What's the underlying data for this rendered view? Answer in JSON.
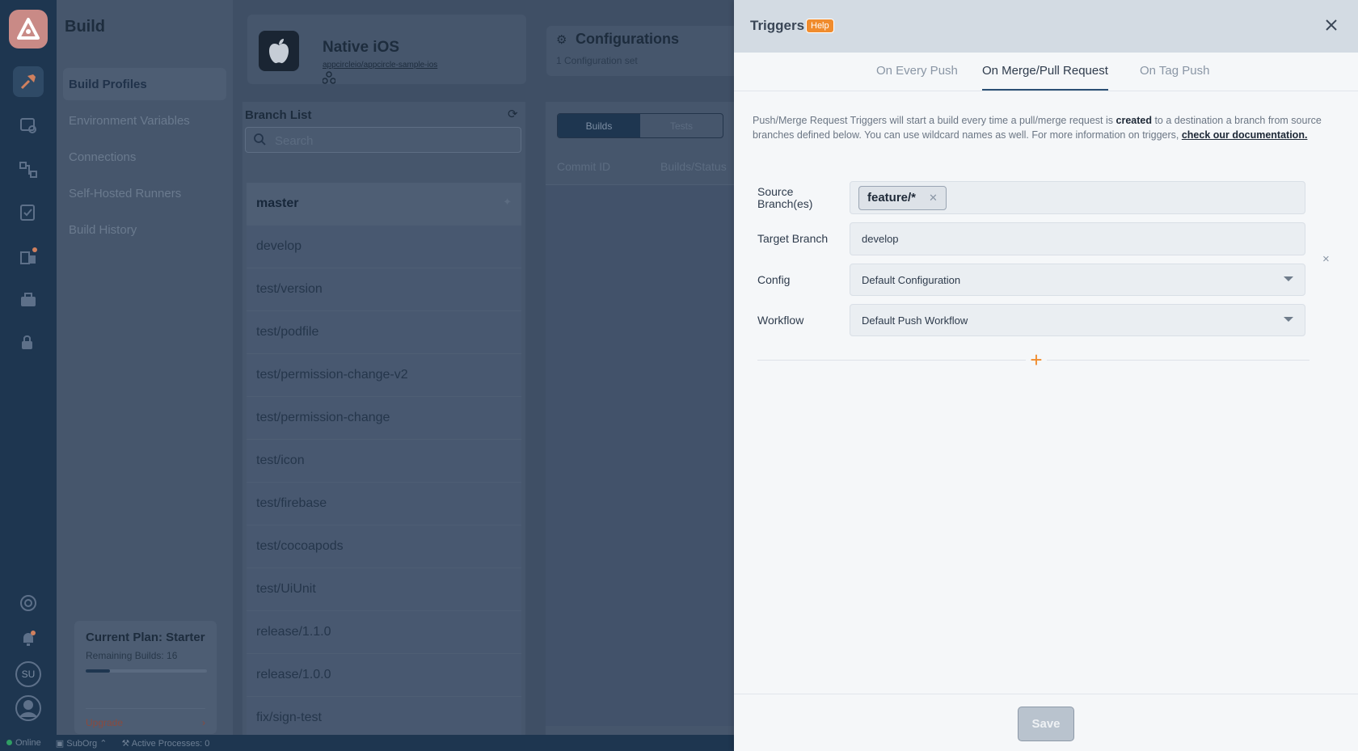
{
  "rail": {
    "icons": [
      "logo-icon",
      "build-hammer-icon",
      "distribution-icon",
      "flow-icon",
      "testing-icon",
      "store-icon",
      "briefcase-icon",
      "lock-icon",
      "support-icon",
      "bell-icon",
      "user-icon"
    ],
    "avatar_initials": "SU"
  },
  "subnav": {
    "title": "Build",
    "items": [
      {
        "label": "Build Profiles",
        "active": true
      },
      {
        "label": "Environment Variables"
      },
      {
        "label": "Connections"
      },
      {
        "label": "Self-Hosted Runners"
      },
      {
        "label": "Build History"
      }
    ],
    "plan": {
      "title": "Current Plan: Starter",
      "remaining": "Remaining Builds: 16",
      "remaining_fraction": 0.2,
      "upgrade": "Upgrade"
    }
  },
  "profile": {
    "name": "Native iOS",
    "repo": "appcircleio/appcircle-sample-ios"
  },
  "configurations": {
    "title": "Configurations",
    "subtitle": "1 Configuration set"
  },
  "branch_list": {
    "title": "Branch List",
    "search_placeholder": "Search",
    "branches": [
      "master",
      "develop",
      "test/version",
      "test/podfile",
      "test/permission-change-v2",
      "test/permission-change",
      "test/icon",
      "test/firebase",
      "test/cocoapods",
      "test/UiUnit",
      "release/1.1.0",
      "release/1.0.0",
      "fix/sign-test"
    ]
  },
  "builds_panel": {
    "tabs": [
      "Builds",
      "Tests"
    ],
    "columns": [
      "Commit ID",
      "Builds/Status"
    ]
  },
  "statusbar": {
    "online": "Online",
    "org": "SubOrg",
    "processes": "Active Processes: 0"
  },
  "drawer": {
    "title": "Triggers",
    "help": "Help",
    "tabs": [
      {
        "label": "On Every Push"
      },
      {
        "label": "On Merge/Pull Request",
        "active": true
      },
      {
        "label": "On Tag Push"
      }
    ],
    "description": {
      "p1": "Push/Merge Request Triggers will start a build every time a pull/merge request is ",
      "bold": "created",
      "p2": " to a destination a branch from source branches defined below. You can use wildcard names as well. For more information on triggers, ",
      "link": "check our documentation."
    },
    "form": {
      "source_label": "Source Branch(es)",
      "source_chips": [
        "feature/*"
      ],
      "target_label": "Target Branch",
      "target_value": "develop",
      "config_label": "Config",
      "config_value": "Default Configuration",
      "workflow_label": "Workflow",
      "workflow_value": "Default Push Workflow"
    },
    "add_symbol": "+",
    "delete_symbol": "×",
    "save_label": "Save"
  }
}
